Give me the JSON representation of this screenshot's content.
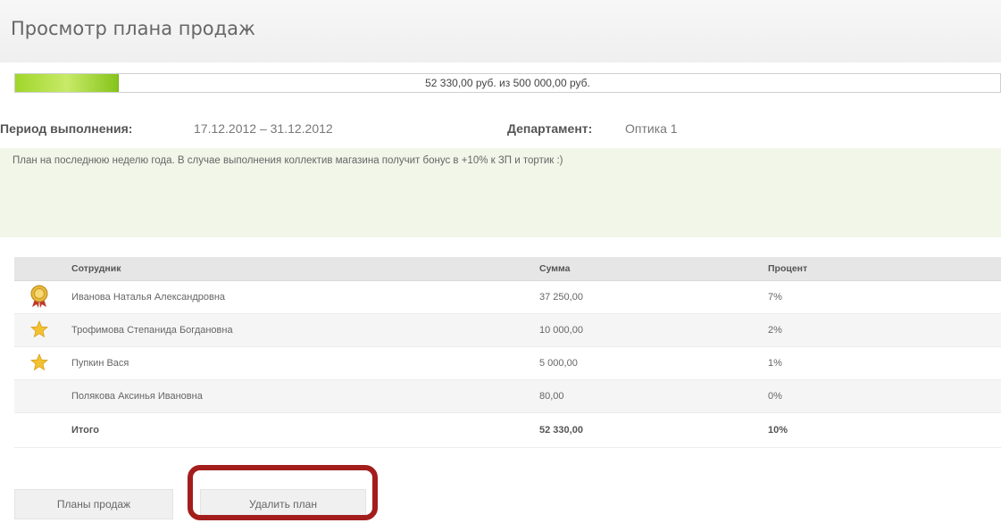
{
  "page": {
    "title": "Просмотр плана продаж"
  },
  "progress": {
    "text": "52 330,00 руб. из 500 000,00 руб.",
    "current": 52330.0,
    "target": 500000.0
  },
  "meta": {
    "period_label": "Период выполнения:",
    "period_value": "17.12.2012 – 31.12.2012",
    "department_label": "Департамент:",
    "department_value": "Оптика 1"
  },
  "note": "План на последнюю неделю года. В случае выполнения коллектив магазина получит бонус в +10% к ЗП и тортик :)",
  "table": {
    "headers": {
      "employee": "Сотрудник",
      "amount": "Сумма",
      "percent": "Процент"
    },
    "rows": [
      {
        "icon": "medal-icon",
        "name": "Иванова Наталья Александровна",
        "amount": "37 250,00",
        "percent": "7%"
      },
      {
        "icon": "star-icon",
        "name": "Трофимова Степанида Богдановна",
        "amount": "10 000,00",
        "percent": "2%"
      },
      {
        "icon": "star-icon",
        "name": "Пупкин Вася",
        "amount": "5 000,00",
        "percent": "1%"
      },
      {
        "icon": "",
        "name": "Полякова Аксинья Ивановна",
        "amount": "80,00",
        "percent": "0%"
      }
    ],
    "total": {
      "label": "Итого",
      "amount": "52 330,00",
      "percent": "10%"
    }
  },
  "buttons": {
    "plans": "Планы продаж",
    "delete": "Удалить план"
  },
  "colors": {
    "progress_fill": "#a6d934",
    "note_bg": "#f1f6e9",
    "highlight": "#a31d1d"
  }
}
